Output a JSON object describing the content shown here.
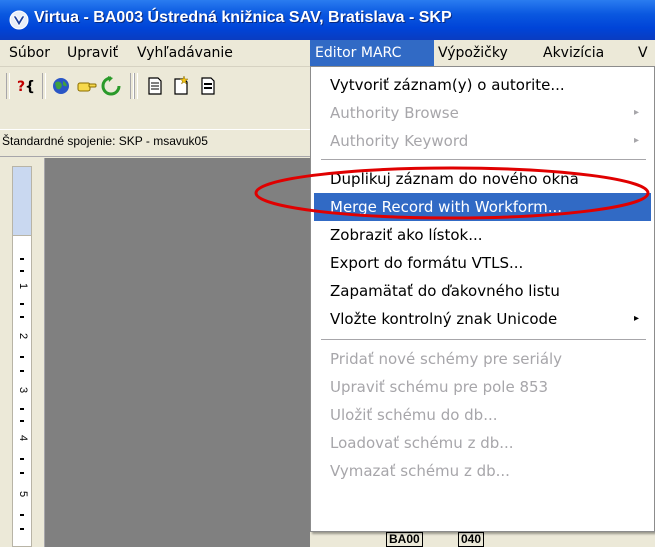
{
  "window": {
    "title": "Virtua - BA003 Ústredná knižnica SAV, Bratislava - SKP",
    "app_icon": "virtua-app-icon"
  },
  "menubar": {
    "items": [
      {
        "label": "Súbor"
      },
      {
        "label": "Upraviť"
      },
      {
        "label": "Vyhľadávanie"
      },
      {
        "label": "Editor MARC",
        "active": true
      },
      {
        "label": "Výpožičky"
      },
      {
        "label": "Akvizícia"
      },
      {
        "label": "V"
      }
    ]
  },
  "toolbar": {
    "buttons": [
      {
        "icon": "query-icon"
      },
      {
        "icon": "globe-icon"
      },
      {
        "icon": "hand-pointer-icon"
      },
      {
        "icon": "refresh-icon"
      },
      {
        "icon": "document-icon"
      },
      {
        "icon": "new-document-icon"
      },
      {
        "icon": "document-list-icon"
      }
    ]
  },
  "connection": {
    "status": "Štandardné spojenie: SKP - msavuk05"
  },
  "ruler": {
    "labels": [
      "1",
      "2",
      "3",
      "4",
      "5"
    ]
  },
  "dropdown": {
    "menu": "Editor MARC",
    "items": [
      {
        "label": "Vytvoriť záznam(y) o autorite...",
        "enabled": true
      },
      {
        "label": "Authority Browse",
        "enabled": false,
        "submenu": true
      },
      {
        "label": "Authority Keyword",
        "enabled": false,
        "submenu": true
      },
      {
        "label": "Duplikuj záznam do nového okna",
        "enabled": true,
        "annotated": true
      },
      {
        "label": "Merge Record with Workform...",
        "enabled": true,
        "highlighted": true
      },
      {
        "label": "Zobraziť ako lístok...",
        "enabled": true
      },
      {
        "label": "Export do formátu VTLS...",
        "enabled": true
      },
      {
        "label": "Zapamätať do ďakovného listu",
        "enabled": true
      },
      {
        "label": "Vložte kontrolný znak Unicode",
        "enabled": true,
        "submenu": true
      },
      {
        "label": "Pridať nové schémy pre seriály",
        "enabled": false
      },
      {
        "label": "Upraviť schému pre pole 853",
        "enabled": false
      },
      {
        "label": "Uložiť schému do db...",
        "enabled": false
      },
      {
        "label": "Loadovať schému z db...",
        "enabled": false
      },
      {
        "label": "Vymazať schému z db...",
        "enabled": false
      }
    ],
    "submenu_arrow": "▸"
  },
  "bottom_strip": {
    "cells": [
      "BA00",
      "040"
    ]
  },
  "colors": {
    "titlebar": "#0044d8",
    "menu_highlight": "#316ac5",
    "annotation": "#e00000",
    "disabled_text": "#a7a6aa"
  }
}
